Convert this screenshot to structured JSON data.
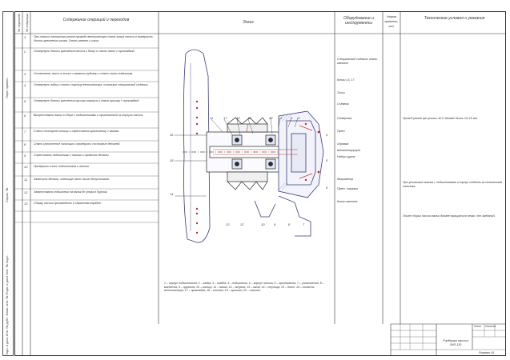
{
  "header": {
    "col_step": "№ перехода",
    "col_op": "№ операции",
    "col_content": "Содержание операций и переходов",
    "col_sketch": "Эскиз",
    "col_tools": "Оборудование и инструменты",
    "col_time": "Норма времени, чел.",
    "col_conditions": "Технические условия и указания"
  },
  "rows": [
    {
      "n": "1",
      "text": "При снятии натяжного ремня привода вентилятора снять кожух насоса и вывернуть болты крепления шкива. Снять ремень и шкив."
    },
    {
      "n": "2",
      "text": "Отвернуть болты крепления насоса к блоку и снять насос с прокладкой."
    },
    {
      "n": "3",
      "text": "Установить насос в тиски с мягкими губками и снять шкив съёмником."
    },
    {
      "n": "4",
      "text": "Отвернуть гайку и снять ступицу вентилятора, используя специальный съёмник."
    },
    {
      "n": "5",
      "text": "Отвернуть болты крепления крышки корпуса и снять крышку с прокладкой."
    },
    {
      "n": "6",
      "text": "Выпрессовать валик в сборе с подшипниками и крыльчаткой из корпуса насоса."
    },
    {
      "n": "7",
      "text": "Снять стопорное кольцо и спрессовать крыльчатку с валика."
    },
    {
      "n": "8",
      "text": "Снять уплотнение сальника и проверить состояние деталей."
    },
    {
      "n": "9",
      "text": "Спрессовать подшипники с валика и промыть детали."
    },
    {
      "n": "10",
      "text": "Проверить износ подшипников и валика."
    },
    {
      "n": "11",
      "text": "Заменить детали, имеющие износ выше допустимого."
    },
    {
      "n": "12",
      "text": "Запрессовать подшипник на валик до упора в буртик."
    },
    {
      "n": "13",
      "text": "Сборку насоса производить в обратном порядке."
    }
  ],
  "tools": [
    "Специальный съёмник, ключи гаечные",
    "Ключи 13, 17",
    "Тиски",
    "Съёмник",
    "Отвёртка",
    "Пресс",
    "Оправка",
    "Штангенциркуль",
    "Набор щупов",
    "Микрометр",
    "Пресс, оправка",
    "Ключи гаечные"
  ],
  "conditions": [
    "Прогиб ремня при усилии 40 Н должен быть 10–15 мм.",
    "При установке валика с подшипниками в корпус следить за положением сальника.",
    "После сборки насоса валик должен вращаться легко, без заеданий."
  ],
  "callouts": [
    "1",
    "2",
    "3",
    "4",
    "5",
    "6",
    "7",
    "8",
    "9",
    "10",
    "11",
    "12",
    "13",
    "14",
    "15",
    "16",
    "17",
    "18",
    "19",
    "20"
  ],
  "legend_text": "1 – корпус подшипников; 2 – гайка; 3 – шайба; 4 – подшипник; 5 – корпус насоса; 6 – крыльчатка; 7 – уплотнение; 8 – манжета; 9 – пружина; 10 – кольцо; 11 – валик; 12 – втулка; 13 – шкив; 14 – ступица; 15 – болт; 16 – лопасть вентилятора; 17 – прокладка; 18 – шпонка; 19 – крышка; 20 – сальник.",
  "side_labels": {
    "top": "Перв. примен.",
    "mid": "Справ. №",
    "bottom": "Подп. и дата  Инв. № дубл.  Взам. инв. №  Подп. и дата  Инв. № подл."
  },
  "title_block": {
    "name": "Разборка насоса",
    "code": "ЗИЛ-130",
    "sheet": "Лист",
    "sheets": "Листов",
    "format": "Формат А1"
  }
}
